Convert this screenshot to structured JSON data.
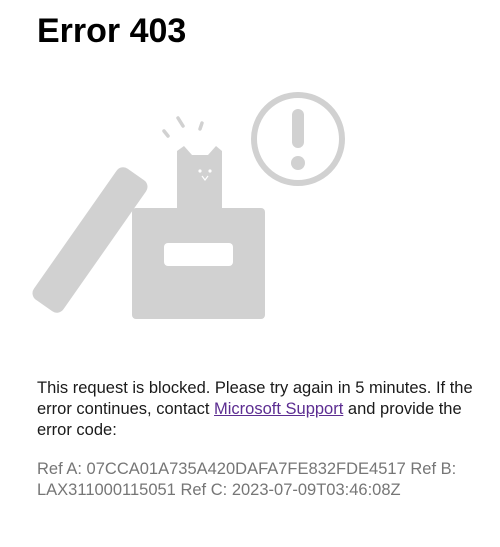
{
  "page": {
    "title": "Error 403"
  },
  "illustration": {
    "icon": "cat-in-box-with-alert-icon",
    "colors": {
      "shape": "#d1d1d1",
      "slot": "#ffffff"
    }
  },
  "message": {
    "text_before_link": "This request is blocked. Please try again in 5 minutes. If the error continues, contact ",
    "link_label": "Microsoft Support",
    "text_after_link": " and provide the error code:",
    "link_color": "#5c2d91"
  },
  "error_refs": {
    "ref_a_label": "Ref A:",
    "ref_a_value": "07CCA01A735A420DAFA7FE832FDE4517",
    "ref_b_label": "Ref B:",
    "ref_b_value": "LAX311000115051",
    "ref_c_label": "Ref C:",
    "ref_c_value": "2023-07-09T03:46:08Z",
    "color": "#767676"
  }
}
